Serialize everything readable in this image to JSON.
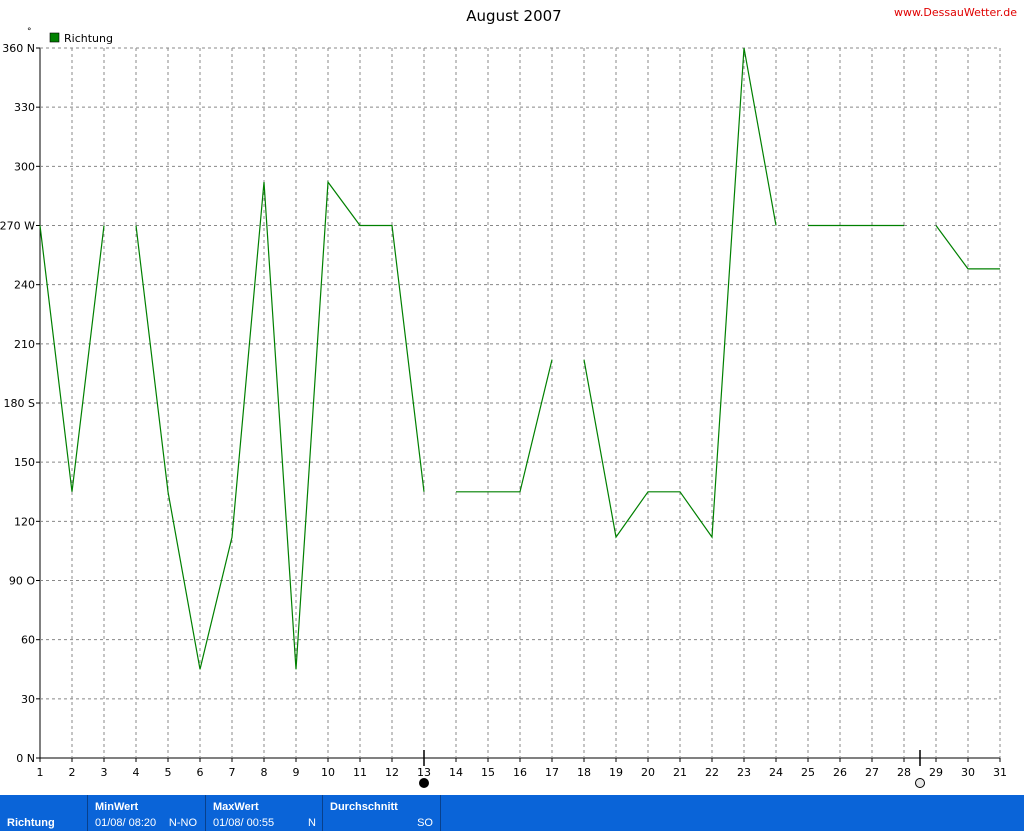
{
  "chart_data": {
    "type": "line",
    "title": "August 2007",
    "source_label": "www.DessauWetter.de",
    "unit": "°",
    "legend": {
      "label": "Richtung",
      "color": "#008000",
      "placement": "top-left"
    },
    "grid": true,
    "xlim": [
      1,
      31
    ],
    "ylim": [
      0,
      360
    ],
    "x_ticks": [
      "1",
      "2",
      "3",
      "4",
      "5",
      "6",
      "7",
      "8",
      "9",
      "10",
      "11",
      "12",
      "13",
      "14",
      "15",
      "16",
      "17",
      "18",
      "19",
      "20",
      "21",
      "22",
      "23",
      "24",
      "25",
      "26",
      "27",
      "28",
      "29",
      "30",
      "31"
    ],
    "y_ticks": [
      {
        "value": 0,
        "label": "0  N"
      },
      {
        "value": 30,
        "label": "30"
      },
      {
        "value": 60,
        "label": "60"
      },
      {
        "value": 90,
        "label": "90  O"
      },
      {
        "value": 120,
        "label": "120"
      },
      {
        "value": 150,
        "label": "150"
      },
      {
        "value": 180,
        "label": "180 S"
      },
      {
        "value": 210,
        "label": "210"
      },
      {
        "value": 240,
        "label": "240"
      },
      {
        "value": 270,
        "label": "270 W"
      },
      {
        "value": 300,
        "label": "300"
      },
      {
        "value": 330,
        "label": "330"
      },
      {
        "value": 360,
        "label": "360 N"
      }
    ],
    "moon_phases": [
      {
        "x": 13,
        "phase": "new-moon"
      },
      {
        "x": 28.5,
        "phase": "full-moon"
      }
    ],
    "series": [
      {
        "name": "Richtung",
        "color": "#008000",
        "segments": [
          [
            [
              1,
              270
            ],
            [
              2,
              135
            ],
            [
              3,
              270
            ]
          ],
          [
            [
              4,
              270
            ],
            [
              5,
              135
            ],
            [
              6,
              45
            ],
            [
              7,
              112
            ],
            [
              8,
              292
            ],
            [
              9,
              45
            ],
            [
              10,
              292
            ],
            [
              11,
              270
            ],
            [
              12,
              270
            ],
            [
              13,
              135
            ]
          ],
          [
            [
              14,
              135
            ],
            [
              15,
              135
            ],
            [
              16,
              135
            ],
            [
              17,
              202
            ]
          ],
          [
            [
              18,
              202
            ],
            [
              19,
              112
            ],
            [
              20,
              135
            ],
            [
              21,
              135
            ],
            [
              22,
              112
            ],
            [
              23,
              360
            ],
            [
              24,
              270
            ]
          ],
          [
            [
              25,
              270
            ],
            [
              26,
              270
            ],
            [
              27,
              270
            ],
            [
              28,
              270
            ]
          ],
          [
            [
              29,
              270
            ],
            [
              30,
              248
            ],
            [
              31,
              248
            ]
          ]
        ]
      }
    ]
  },
  "stats": {
    "label": "Richtung",
    "min": {
      "header": "MinWert",
      "date": "01/08/  08:20",
      "dir": "N-NO"
    },
    "max": {
      "header": "MaxWert",
      "date": "01/08/  00:55",
      "dir": "N"
    },
    "avg": {
      "header": "Durchschnitt",
      "dir": "SO"
    }
  }
}
